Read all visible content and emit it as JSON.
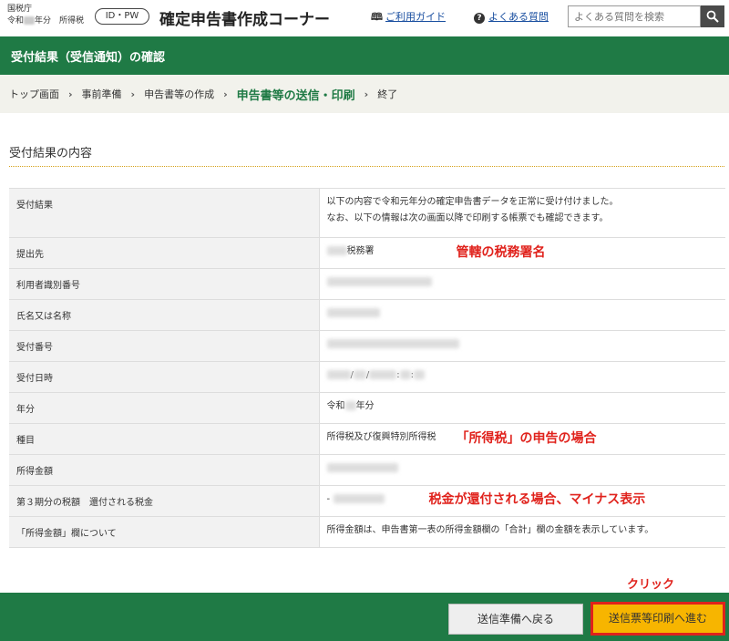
{
  "header": {
    "agency_line1": "国税庁",
    "agency_line2_pre": "令和",
    "agency_line2_post": "年分　所得税",
    "badge": "ID・PW",
    "corner_title": "確定申告書作成コーナー",
    "guide_link": "ご利用ガイド",
    "faq_link": "よくある質問",
    "search_placeholder": "よくある質問を検索"
  },
  "page_title": "受付結果（受信通知）の確認",
  "breadcrumb": {
    "items": [
      "トップ画面",
      "事前準備",
      "申告書等の作成",
      "申告書等の送信・印刷",
      "終了"
    ],
    "current_index": 3
  },
  "section_heading": "受付結果の内容",
  "table": {
    "rows": [
      {
        "label": "受付結果",
        "value_line1": "以下の内容で令和元年分の確定申告書データを正常に受け付けました。",
        "value_line2": "なお、以下の情報は次の画面以降で印刷する帳票でも確認できます。"
      },
      {
        "label": "提出先",
        "value": "税務署"
      },
      {
        "label": "利用者識別番号",
        "value": ""
      },
      {
        "label": "氏名又は名称",
        "value": ""
      },
      {
        "label": "受付番号",
        "value": ""
      },
      {
        "label": "受付日時",
        "value_sep1": "/",
        "value_sep2": "/",
        "value_sep3": ":",
        "value_sep4": ":"
      },
      {
        "label": "年分",
        "value_pre": "令和",
        "value_post": "年分"
      },
      {
        "label": "種目",
        "value": "所得税及び復興特別所得税"
      },
      {
        "label": "所得金額",
        "value": ""
      },
      {
        "label": "第３期分の税額　還付される税金",
        "value": "-"
      },
      {
        "label": "「所得金額」欄について",
        "value": "所得金額は、申告書第一表の所得金額欄の「合計」欄の金額を表示しています。"
      }
    ]
  },
  "annotations": {
    "tax_office": "管轄の税務署名",
    "income_tax": "「所得税」の申告の場合",
    "refund": "税金が還付される場合、マイナス表示",
    "click": "クリック"
  },
  "footer": {
    "back_button": "送信準備へ戻る",
    "next_button": "送信票等印刷へ進む"
  },
  "colors": {
    "brand_green": "#1f7a45",
    "accent_orange": "#f7b500",
    "annotation_red": "#e0221c"
  }
}
